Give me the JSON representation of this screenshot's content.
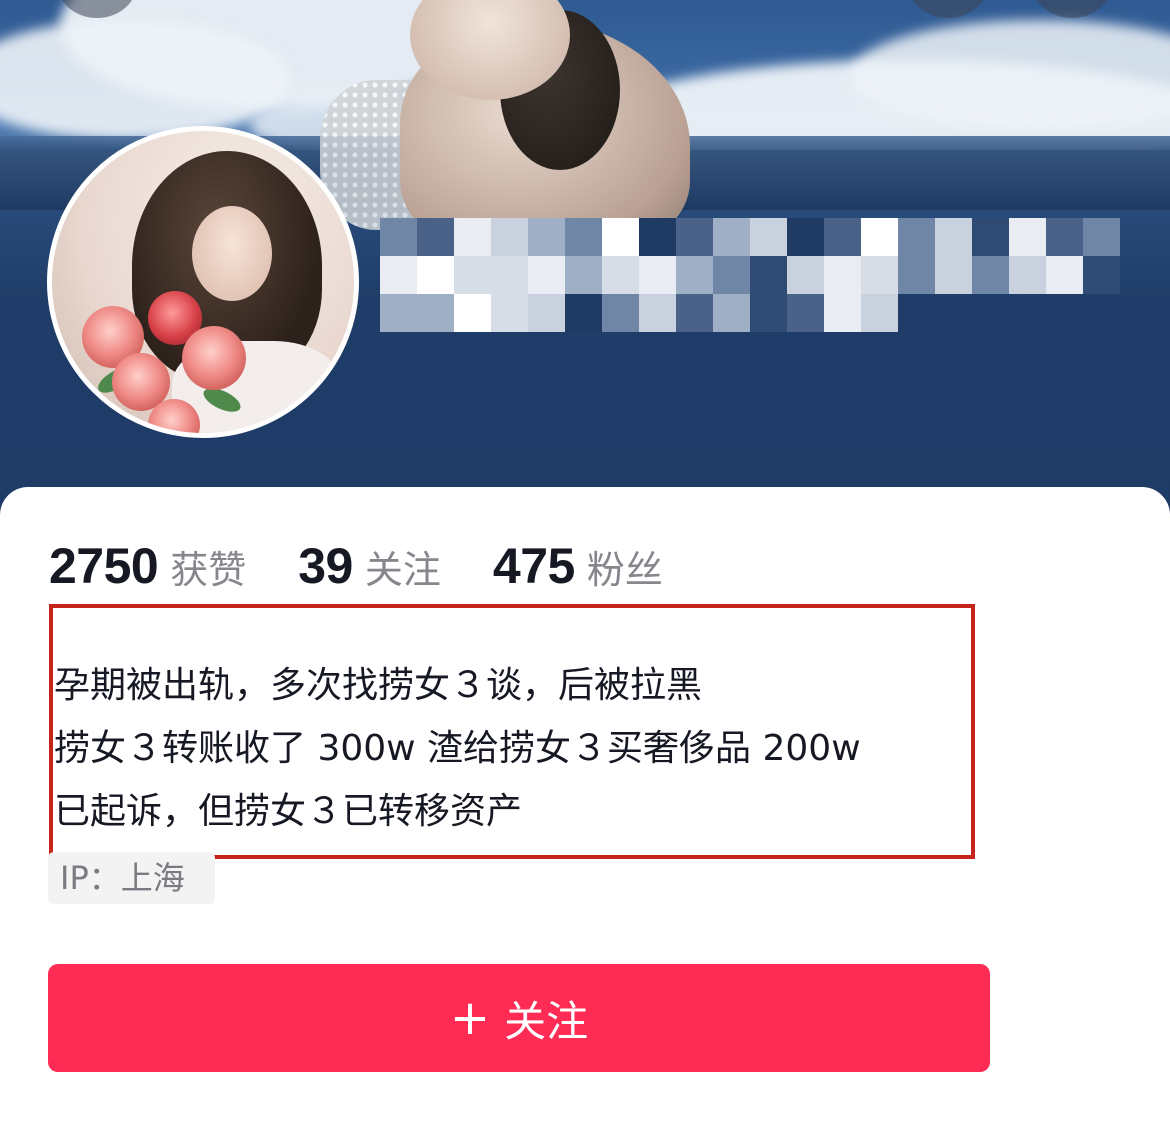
{
  "header": {
    "username_display": "",
    "top_buttons": [
      "back-icon",
      "search-icon",
      "more-icon"
    ]
  },
  "stats": [
    {
      "count": "2750",
      "label": "获赞"
    },
    {
      "count": "39",
      "label": "关注"
    },
    {
      "count": "475",
      "label": "粉丝"
    }
  ],
  "bio": {
    "lines": [
      "孕期被出轨，多次找捞女３谈，后被拉黑",
      "捞女３转账收了 300w 渣给捞女３买奢侈品 200w",
      "已起诉，但捞女３已转移资产"
    ],
    "highlight_color": "#c6231d"
  },
  "ip": {
    "label": "IP：上海"
  },
  "follow_button": {
    "icon": "plus-icon",
    "icon_glyph": "+",
    "label": "关注",
    "color": "#fe2c55"
  }
}
